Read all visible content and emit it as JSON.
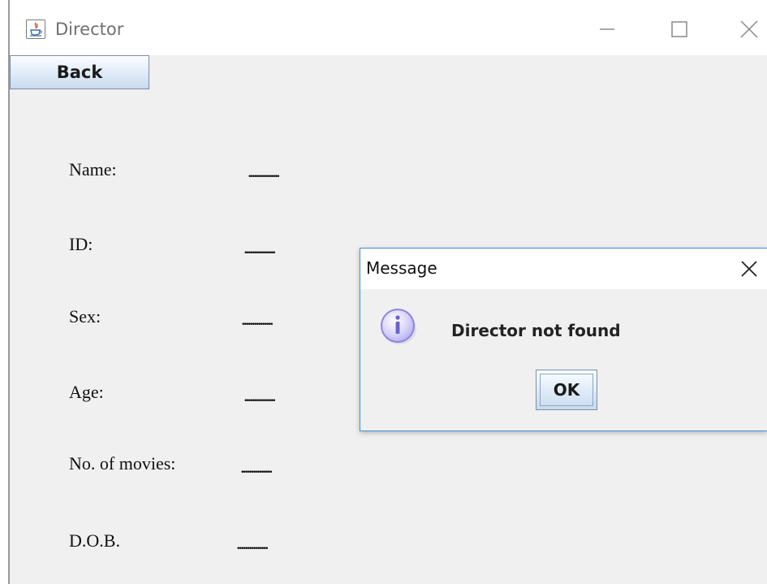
{
  "window": {
    "title": "Director",
    "icon": "java-cup-icon",
    "controls": [
      "minimize-icon",
      "maximize-icon",
      "close-icon"
    ]
  },
  "toolbar": {
    "back_label": "Back"
  },
  "details": [
    {
      "label": "Name:",
      "value": "..............."
    },
    {
      "label": "ID:",
      "value": "..............."
    },
    {
      "label": "Sex:",
      "value": "..............."
    },
    {
      "label": "Age:",
      "value": "..............."
    },
    {
      "label": "No. of movies:",
      "value": "..............."
    },
    {
      "label": "D.O.B.",
      "value": "..............."
    }
  ],
  "dialog": {
    "title": "Message",
    "icon": "info-icon",
    "message": "Director not found",
    "ok_label": "OK",
    "close_icon": "close-icon"
  },
  "colors": {
    "background": "#f0f0f0",
    "dialog_border": "#4a8fd8",
    "button_border": "#7a8ea8",
    "info_icon": "#8d86e0"
  }
}
